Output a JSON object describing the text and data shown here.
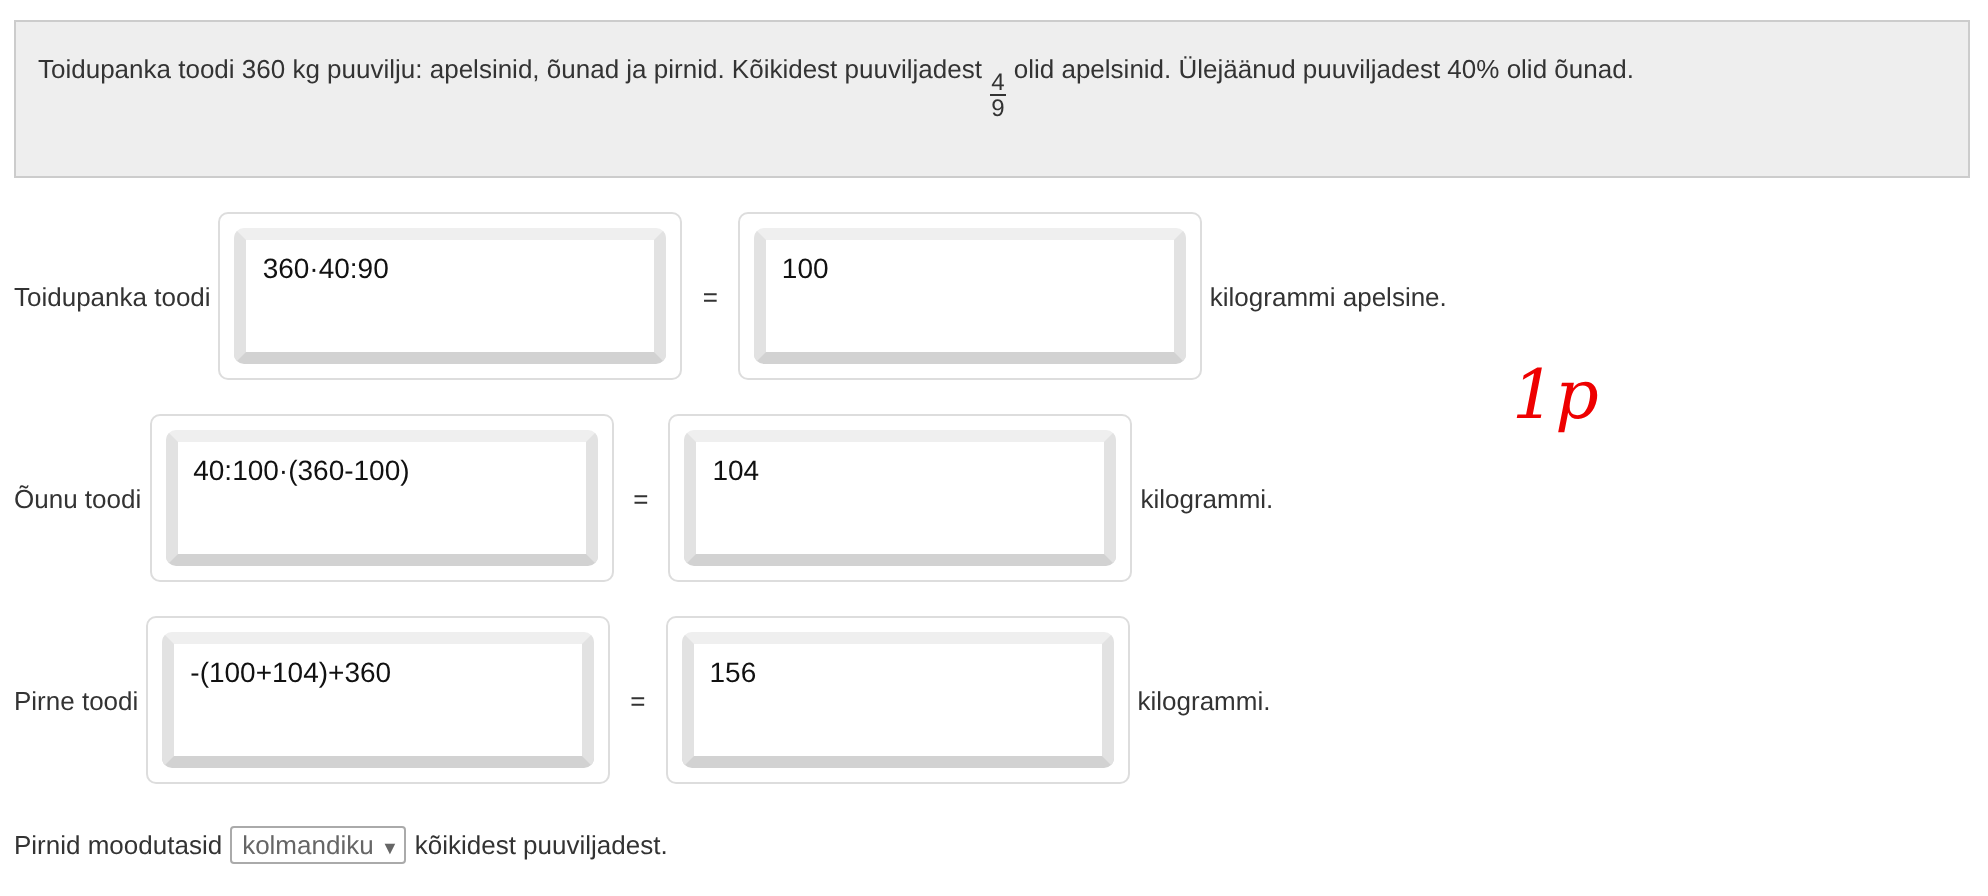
{
  "problem": {
    "text_before": "Toidupanka toodi 360 kg puuvilju: apelsinid, õunad ja pirnid. Kõikidest puuviljadest",
    "fraction": {
      "numerator": "4",
      "denominator": "9"
    },
    "text_after": "olid apelsinid. Ülejäänud puuviljadest 40% olid õunad."
  },
  "rows": [
    {
      "label": "Toidupanka toodi",
      "expression": "360·40:90",
      "equals": "=",
      "result": "100",
      "unit": "kilogrammi apelsine."
    },
    {
      "label": "Õunu toodi",
      "expression": "40:100·(360-100)",
      "equals": "=",
      "result": "104",
      "unit": "kilogrammi."
    },
    {
      "label": "Pirne toodi",
      "expression": "-(100+104)+360",
      "equals": "=",
      "result": "156",
      "unit": "kilogrammi."
    }
  ],
  "final": {
    "text_before": "Pirnid moodutasid",
    "select": {
      "value": "kolmandiku",
      "arrow": "▼"
    },
    "text_after": "kõikidest puuviljadest."
  },
  "annotation": "1p"
}
